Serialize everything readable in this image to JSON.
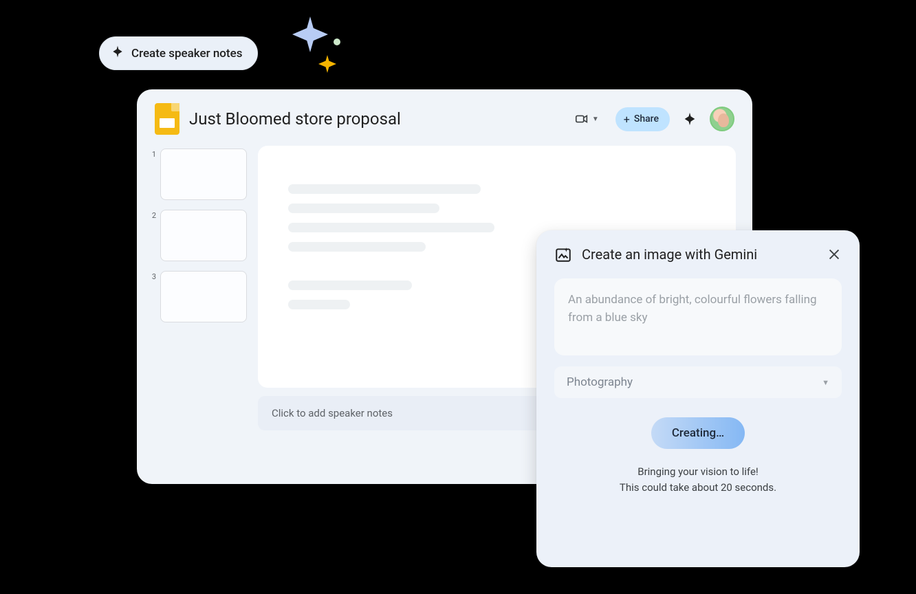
{
  "suggestion": {
    "label": "Create speaker notes"
  },
  "document": {
    "title": "Just Bloomed store proposal"
  },
  "header": {
    "share_label": "Share"
  },
  "thumbnails": [
    {
      "index": "1"
    },
    {
      "index": "2"
    },
    {
      "index": "3"
    }
  ],
  "speaker_notes": {
    "placeholder": "Click to add speaker notes"
  },
  "gemini_panel": {
    "title": "Create an image with Gemini",
    "prompt": "An abundance of bright, colourful flowers falling from a blue sky",
    "style_selected": "Photography",
    "button_label": "Creating…",
    "status_line1": "Bringing your vision to life!",
    "status_line2": "This could take about 20 seconds."
  }
}
